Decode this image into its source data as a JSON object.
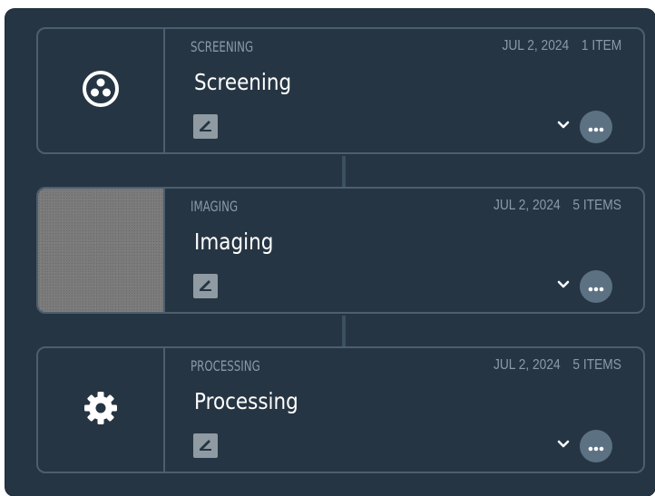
{
  "cards": [
    {
      "category": "SCREENING",
      "date": "JUL 2, 2024",
      "count": "1 ITEM",
      "title": "Screening",
      "icon": "screening-icon"
    },
    {
      "category": "IMAGING",
      "date": "JUL 2, 2024",
      "count": "5 ITEMS",
      "title": "Imaging",
      "icon": "image-thumbnail"
    },
    {
      "category": "PROCESSING",
      "date": "JUL 2, 2024",
      "count": "5 ITEMS",
      "title": "Processing",
      "icon": "gear-icon"
    }
  ],
  "colors": {
    "panel_bg": "#263543",
    "card_border": "#4a5f70",
    "muted_text": "#8a9aa8",
    "title_text": "#ffffff",
    "more_button_bg": "#5c7283"
  }
}
